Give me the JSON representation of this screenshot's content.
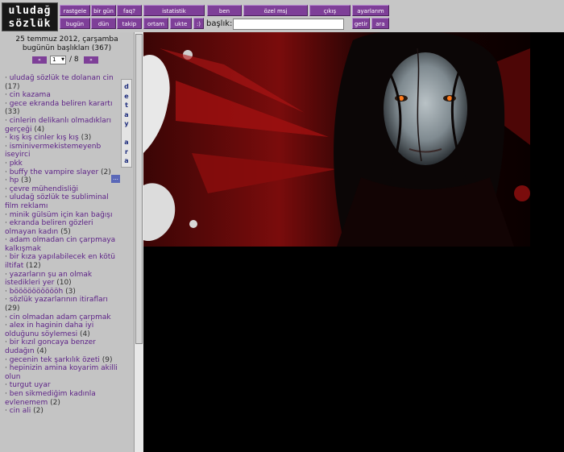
{
  "logo": {
    "line1": "uludağ",
    "line2": "sözlük"
  },
  "nav": {
    "row1": [
      "rastgele",
      "bir gün",
      "faq?",
      "istatistik",
      "ben",
      "özel msj",
      "çıkış",
      "ayarlarım"
    ],
    "row2": [
      "bugün",
      "dün",
      "takip",
      "ortam",
      "ukte",
      ":)"
    ],
    "search_label": "başlık:",
    "search_value": "",
    "getir": "getir",
    "ara": "ara"
  },
  "sidebar": {
    "date": "25 temmuz 2012, çarşamba",
    "today": "bugünün başlıkları (367)",
    "prev": "«",
    "next": "»",
    "page_current": "1",
    "page_total": "/ 8",
    "detay_ara": [
      "d",
      "e",
      "t",
      "a",
      "y",
      "",
      "a",
      "r",
      "a"
    ],
    "more": "...",
    "topics": [
      {
        "title": "uludağ sözlük te dolanan cin",
        "count": "(17)"
      },
      {
        "title": "cin kazama",
        "count": ""
      },
      {
        "title": "gece ekranda beliren karartı",
        "count": "(33)"
      },
      {
        "title": "cinlerin delikanlı olmadıkları gerçeği",
        "count": "(4)"
      },
      {
        "title": "kış kış cinler kış kış",
        "count": "(3)"
      },
      {
        "title": "isminivermekistemeyenb iseyirci",
        "count": ""
      },
      {
        "title": "pkk",
        "count": ""
      },
      {
        "title": "buffy the vampire slayer",
        "count": "(2)"
      },
      {
        "title": "hp",
        "count": "(3)"
      },
      {
        "title": "çevre mühendisliği",
        "count": ""
      },
      {
        "title": "uludağ sözlük te subliminal film reklamı",
        "count": ""
      },
      {
        "title": "minik gülsüm için kan bağışı",
        "count": ""
      },
      {
        "title": "ekranda beliren gözleri olmayan kadın",
        "count": "(5)"
      },
      {
        "title": "adam olmadan cin çarpmaya kalkışmak",
        "count": ""
      },
      {
        "title": "bir kıza yapılabilecek en kötü iltifat",
        "count": "(12)"
      },
      {
        "title": "yazarların şu an olmak istedikleri yer",
        "count": "(10)"
      },
      {
        "title": "bööööööööööh",
        "count": "(3)"
      },
      {
        "title": "sözlük yazarlarının itirafları",
        "count": "(29)"
      },
      {
        "title": "cin olmadan adam çarpmak",
        "count": ""
      },
      {
        "title": "alex in haginin daha iyi olduğunu söylemesi",
        "count": "(4)"
      },
      {
        "title": "bir kızıl goncaya benzer dudağın",
        "count": "(4)"
      },
      {
        "title": "gecenin tek şarkılık özeti",
        "count": "(9)"
      },
      {
        "title": "hepinizin amina koyarim akilli olun",
        "count": ""
      },
      {
        "title": "turgut uyar",
        "count": ""
      },
      {
        "title": "ben sikmediğim kadınla evlenemem",
        "count": "(2)"
      },
      {
        "title": "cin ali",
        "count": "(2)"
      }
    ]
  },
  "colors": {
    "nav_purple": "#7e3f98",
    "link_purple": "#5b1f86",
    "panel_gray": "#c4c4c4",
    "main_bg": "#000000",
    "blood_red": "#8a0d0d"
  }
}
